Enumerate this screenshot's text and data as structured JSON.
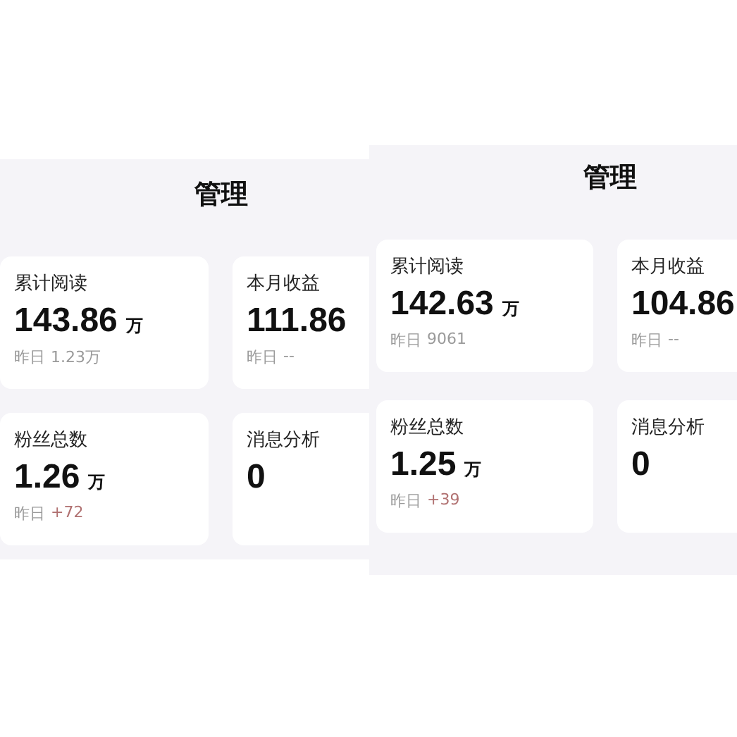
{
  "panels": [
    {
      "title": "管理",
      "cards": [
        {
          "label": "累计阅读",
          "value": "143.86",
          "unit": "万",
          "yesterday_label": "昨日",
          "yesterday_value": "1.23万",
          "highlight": false
        },
        {
          "label": "本月收益",
          "value": "111.86",
          "yesterday_label": "昨日",
          "yesterday_value": "--",
          "highlight": false
        },
        {
          "label": "粉丝总数",
          "value": "1.26",
          "unit": "万",
          "yesterday_label": "昨日",
          "yesterday_value": "+72",
          "highlight": true
        },
        {
          "label": "消息分析",
          "value": "0"
        }
      ]
    },
    {
      "title": "管理",
      "cards": [
        {
          "label": "累计阅读",
          "value": "142.63",
          "unit": "万",
          "yesterday_label": "昨日",
          "yesterday_value": "9061",
          "highlight": false
        },
        {
          "label": "本月收益",
          "value": "104.86",
          "yesterday_label": "昨日",
          "yesterday_value": "--",
          "highlight": false
        },
        {
          "label": "粉丝总数",
          "value": "1.25",
          "unit": "万",
          "yesterday_label": "昨日",
          "yesterday_value": "+39",
          "highlight": true
        },
        {
          "label": "消息分析",
          "value": "0"
        }
      ]
    }
  ]
}
